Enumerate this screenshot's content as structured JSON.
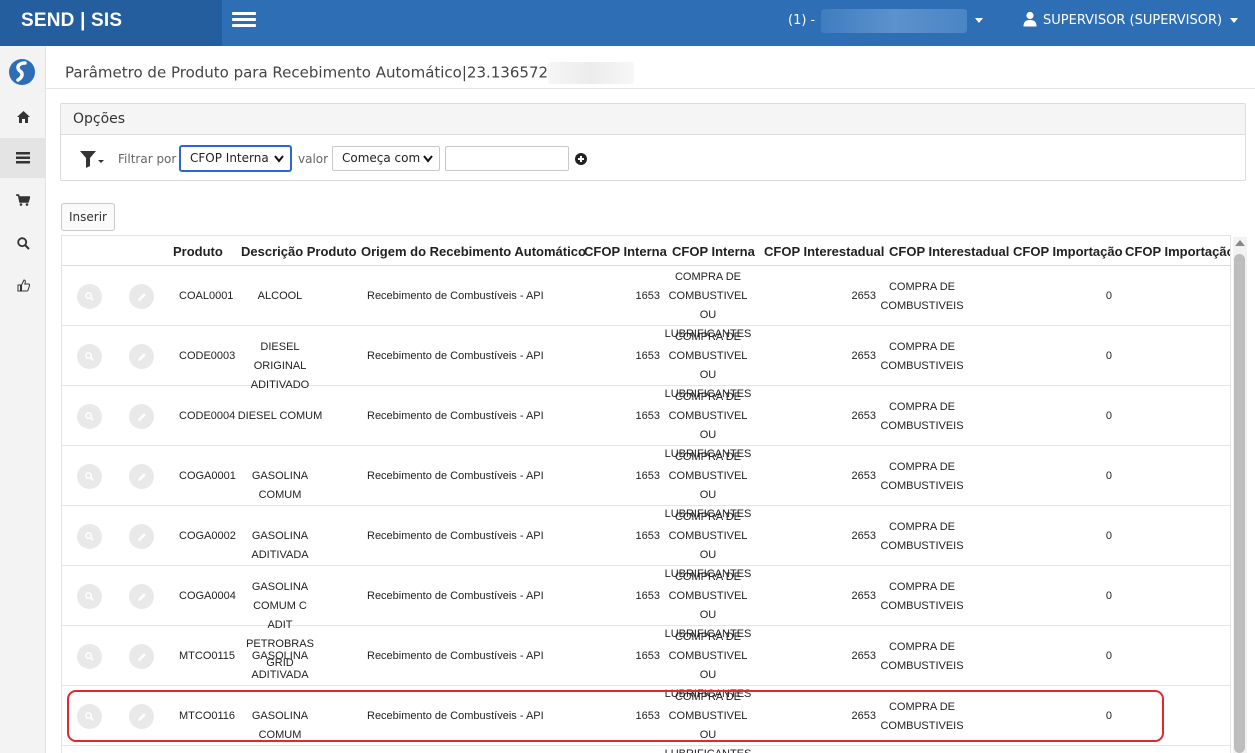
{
  "app": {
    "brand": "SEND | SIS"
  },
  "header": {
    "company_prefix": "(1) -",
    "user": "SUPERVISOR (SUPERVISOR)"
  },
  "page": {
    "title": "Parâmetro de Produto para Recebimento Automático|23.136572"
  },
  "options": {
    "title": "Opções",
    "filter_label": "Filtrar por",
    "filter_value": "CFOP Interna",
    "value_label": "valor",
    "match_value": "Começa com",
    "search_value": ""
  },
  "insert_label": "Inserir",
  "table": {
    "headers": [
      "Produto",
      "Descrição Produto",
      "Origem do Recebimento Automático",
      "CFOP Interna",
      "CFOP Interna",
      "CFOP Interestadual",
      "CFOP Interestadual",
      "CFOP Importação",
      "CFOP Importação"
    ],
    "rows": [
      {
        "produto": "COAL0001",
        "desc": [
          "ALCOOL"
        ],
        "origem": "Recebimento de Combustíveis - API",
        "cfop_int": "1653",
        "cfop_int_desc": [
          "COMPRA DE",
          "COMBUSTIVEL OU",
          "LUBRIFICANTES"
        ],
        "cfop_inter": "2653",
        "cfop_inter_desc": [
          "COMPRA DE",
          "COMBUSTIVEIS"
        ],
        "cfop_imp": "0"
      },
      {
        "produto": "CODE0003",
        "desc": [
          "DIESEL ORIGINAL",
          "ADITIVADO"
        ],
        "origem": "Recebimento de Combustíveis - API",
        "cfop_int": "1653",
        "cfop_int_desc": [
          "COMPRA DE",
          "COMBUSTIVEL OU",
          "LUBRIFICANTES"
        ],
        "cfop_inter": "2653",
        "cfop_inter_desc": [
          "COMPRA DE",
          "COMBUSTIVEIS"
        ],
        "cfop_imp": "0"
      },
      {
        "produto": "CODE0004",
        "desc": [
          "DIESEL COMUM"
        ],
        "origem": "Recebimento de Combustíveis - API",
        "cfop_int": "1653",
        "cfop_int_desc": [
          "COMPRA DE",
          "COMBUSTIVEL OU",
          "LUBRIFICANTES"
        ],
        "cfop_inter": "2653",
        "cfop_inter_desc": [
          "COMPRA DE",
          "COMBUSTIVEIS"
        ],
        "cfop_imp": "0"
      },
      {
        "produto": "COGA0001",
        "desc": [
          "GASOLINA COMUM"
        ],
        "origem": "Recebimento de Combustíveis - API",
        "cfop_int": "1653",
        "cfop_int_desc": [
          "COMPRA DE",
          "COMBUSTIVEL OU",
          "LUBRIFICANTES"
        ],
        "cfop_inter": "2653",
        "cfop_inter_desc": [
          "COMPRA DE",
          "COMBUSTIVEIS"
        ],
        "cfop_imp": "0"
      },
      {
        "produto": "COGA0002",
        "desc": [
          "GASOLINA ADITIVADA"
        ],
        "origem": "Recebimento de Combustíveis - API",
        "cfop_int": "1653",
        "cfop_int_desc": [
          "COMPRA DE",
          "COMBUSTIVEL OU",
          "LUBRIFICANTES"
        ],
        "cfop_inter": "2653",
        "cfop_inter_desc": [
          "COMPRA DE",
          "COMBUSTIVEIS"
        ],
        "cfop_imp": "0"
      },
      {
        "produto": "COGA0004",
        "desc": [
          "GASOLINA COMUM C",
          "ADIT PETROBRAS GRID"
        ],
        "origem": "Recebimento de Combustíveis - API",
        "cfop_int": "1653",
        "cfop_int_desc": [
          "COMPRA DE",
          "COMBUSTIVEL OU",
          "LUBRIFICANTES"
        ],
        "cfop_inter": "2653",
        "cfop_inter_desc": [
          "COMPRA DE",
          "COMBUSTIVEIS"
        ],
        "cfop_imp": "0"
      },
      {
        "produto": "MTCO0115",
        "desc": [
          "GASOLINA ADITIVADA"
        ],
        "origem": "Recebimento de Combustíveis - API",
        "cfop_int": "1653",
        "cfop_int_desc": [
          "COMPRA DE",
          "COMBUSTIVEL OU",
          "LUBRIFICANTES"
        ],
        "cfop_inter": "2653",
        "cfop_inter_desc": [
          "COMPRA DE",
          "COMBUSTIVEIS"
        ],
        "cfop_imp": "0"
      },
      {
        "produto": "MTCO0116",
        "desc": [
          "GASOLINA COMUM"
        ],
        "origem": "Recebimento de Combustíveis - API",
        "cfop_int": "1653",
        "cfop_int_desc": [
          "COMPRA DE",
          "COMBUSTIVEL OU",
          "LUBRIFICANTES"
        ],
        "cfop_inter": "2653",
        "cfop_inter_desc": [
          "COMPRA DE",
          "COMBUSTIVEIS"
        ],
        "cfop_imp": "0"
      }
    ]
  },
  "colors": {
    "topbar": "#2e6eb5",
    "brand_bg": "#255e9f",
    "highlight": "#e0282e"
  }
}
